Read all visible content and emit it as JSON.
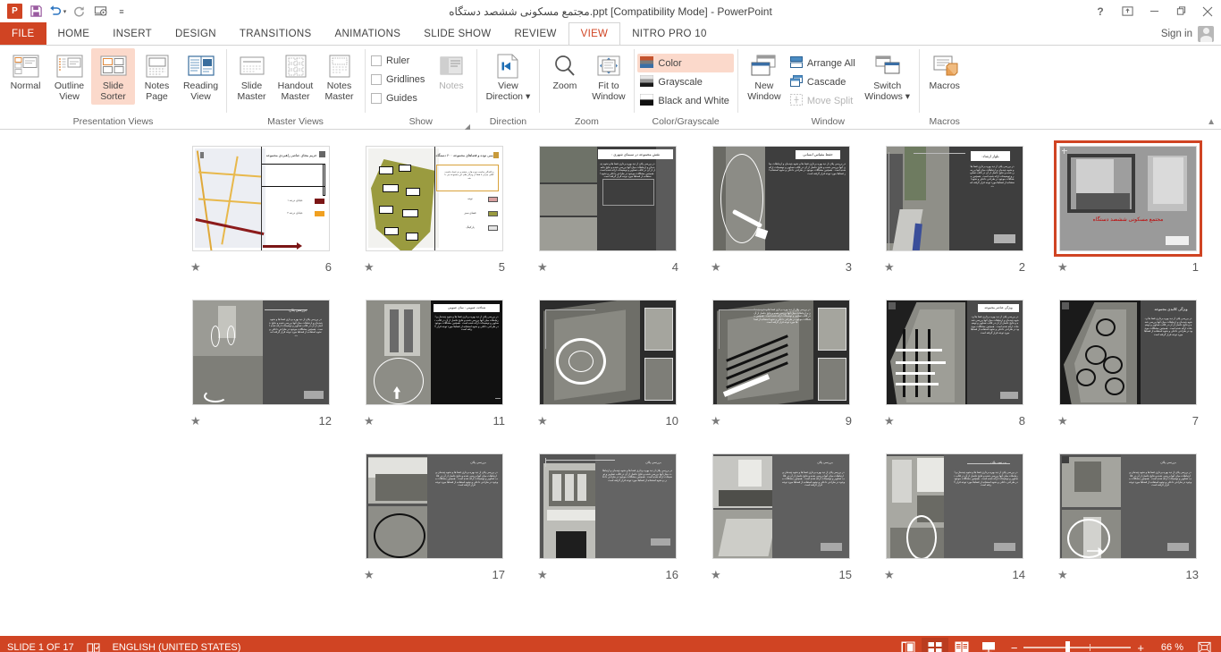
{
  "window": {
    "title": "مجتمع مسکونی ششصد دستگاه.ppt [Compatibility Mode] - PowerPoint",
    "help_icon": "?",
    "ribbon_display_icon": "ribbon-display-options-icon",
    "minimize_icon": "—",
    "restore_icon": "❐",
    "close_icon": "✕",
    "sign_in": "Sign in"
  },
  "quick_access": {
    "logo": "P",
    "save": "save-icon",
    "undo": "undo-icon",
    "redo": "redo-icon",
    "start_slideshow": "start-from-beginning-icon",
    "customize": "customize-quick-access-toolbar-icon"
  },
  "tabs": [
    {
      "label": "FILE",
      "state": "file"
    },
    {
      "label": "HOME",
      "state": "normal"
    },
    {
      "label": "INSERT",
      "state": "normal"
    },
    {
      "label": "DESIGN",
      "state": "normal"
    },
    {
      "label": "TRANSITIONS",
      "state": "normal"
    },
    {
      "label": "ANIMATIONS",
      "state": "normal"
    },
    {
      "label": "SLIDE SHOW",
      "state": "normal"
    },
    {
      "label": "REVIEW",
      "state": "normal"
    },
    {
      "label": "VIEW",
      "state": "active"
    },
    {
      "label": "NITRO PRO 10",
      "state": "normal"
    }
  ],
  "ribbon": {
    "collapse_icon": "^",
    "groups": [
      {
        "name": "Presentation Views",
        "label": "Presentation Views",
        "buttons": [
          {
            "line1": "Normal",
            "line2": "",
            "selected": false
          },
          {
            "line1": "Outline",
            "line2": "View",
            "selected": false
          },
          {
            "line1": "Slide",
            "line2": "Sorter",
            "selected": true
          },
          {
            "line1": "Notes",
            "line2": "Page",
            "selected": false
          },
          {
            "line1": "Reading",
            "line2": "View",
            "selected": false
          }
        ]
      },
      {
        "name": "Master Views",
        "label": "Master Views",
        "buttons": [
          {
            "line1": "Slide",
            "line2": "Master",
            "selected": false
          },
          {
            "line1": "Handout",
            "line2": "Master",
            "selected": false
          },
          {
            "line1": "Notes",
            "line2": "Master",
            "selected": false
          }
        ]
      },
      {
        "name": "Show",
        "label": "Show",
        "has_dialog_launcher": true,
        "checkboxes": [
          {
            "label": "Ruler",
            "checked": false
          },
          {
            "label": "Gridlines",
            "checked": false
          },
          {
            "label": "Guides",
            "checked": false
          }
        ],
        "buttons": [
          {
            "line1": "Notes",
            "line2": "",
            "selected": false,
            "disabled": true
          }
        ]
      },
      {
        "name": "Direction",
        "label": "Direction",
        "buttons": [
          {
            "line1": "View",
            "line2": "Direction ▾",
            "selected": false
          }
        ]
      },
      {
        "name": "Zoom",
        "label": "Zoom",
        "buttons": [
          {
            "line1": "Zoom",
            "line2": "",
            "selected": false
          },
          {
            "line1": "Fit to",
            "line2": "Window",
            "selected": false
          }
        ]
      },
      {
        "name": "Color/Grayscale",
        "label": "Color/Grayscale",
        "options": [
          {
            "label": "Color",
            "selected": true
          },
          {
            "label": "Grayscale",
            "selected": false
          },
          {
            "label": "Black and White",
            "selected": false
          }
        ]
      },
      {
        "name": "Window",
        "label": "Window",
        "buttons": [
          {
            "line1": "New",
            "line2": "Window",
            "selected": false
          }
        ],
        "options": [
          {
            "label": "Arrange All",
            "disabled": false
          },
          {
            "label": "Cascade",
            "disabled": false
          },
          {
            "label": "Move Split",
            "disabled": true
          }
        ],
        "buttons2": [
          {
            "line1": "Switch",
            "line2": "Windows ▾",
            "selected": false
          }
        ]
      },
      {
        "name": "Macros",
        "label": "Macros",
        "buttons": [
          {
            "line1": "Macros",
            "line2": "",
            "selected": false
          }
        ]
      }
    ]
  },
  "sorter": {
    "slides": [
      {
        "number": "6",
        "star": "★",
        "selected": false,
        "kind": "map-plan",
        "title": "حریم بنجای عناصر راهبردی مجموعه",
        "legend": [
          "خیابان درجه ۱",
          "خیابان درجه ۲"
        ]
      },
      {
        "number": "5",
        "star": "★",
        "selected": false,
        "kind": "map-green",
        "title": "بررسی توده و فضاهای مجموعه ۶۰۰ دستگاه",
        "legend": [
          "توده",
          "فضای سبز",
          "پارکینگ"
        ]
      },
      {
        "number": "4",
        "star": "★",
        "selected": false,
        "kind": "dark-photos3",
        "title": "نقش مجموعه در سیمای شهری :"
      },
      {
        "number": "3",
        "star": "★",
        "selected": false,
        "kind": "dark-ellipse",
        "title": "حفظ مقیاس انسانی"
      },
      {
        "number": "2",
        "star": "★",
        "selected": false,
        "kind": "dark-street",
        "title": "بلوار ارشاد:"
      },
      {
        "number": "1",
        "star": "★",
        "selected": true,
        "kind": "cover",
        "title": "مجتمع مسکونی ششصد دستگاه"
      },
      {
        "number": "12",
        "star": "★",
        "selected": false,
        "kind": "interior-arrow",
        "title": "بررسی پلان"
      },
      {
        "number": "11",
        "star": "★",
        "selected": false,
        "kind": "facade-circle",
        "title": "شناخت عمومی : نمای عمومی"
      },
      {
        "number": "10",
        "star": "★",
        "selected": false,
        "kind": "aerial-flower",
        "title": ""
      },
      {
        "number": "9",
        "star": "★",
        "selected": false,
        "kind": "aerial-lines",
        "title": ""
      },
      {
        "number": "8",
        "star": "★",
        "selected": false,
        "kind": "aerial-grid",
        "title": "ویژگی عناصر مجموعه"
      },
      {
        "number": "7",
        "star": "★",
        "selected": false,
        "kind": "aerial-circles",
        "title": "ویژگی کالبدی مجموعه"
      },
      {
        "number": "17",
        "star": "★",
        "selected": false,
        "kind": "photo-ellipse",
        "title": "بررسی پلان"
      },
      {
        "number": "16",
        "star": "★",
        "selected": false,
        "kind": "photo-room",
        "title": "بررسی پلان"
      },
      {
        "number": "15",
        "star": "★",
        "selected": false,
        "kind": "photo-room2",
        "title": "بررسی پلان"
      },
      {
        "number": "14",
        "star": "★",
        "selected": false,
        "kind": "photo-kitchen",
        "title": "بررسی پلان"
      },
      {
        "number": "13",
        "star": "★",
        "selected": false,
        "kind": "photo-sofa",
        "title": "بررسی پلان"
      }
    ],
    "body_text": "در بررسی پلان از دید بهره برداری فضا ها و نحوه چیدمان و ارتباطات میان آنها بررسی شده و نتایج حاصل از آن در قالب تصاویر و توضیحات ارائه شده است . همچنین مشکلات موجود در طراحی داخلی و نحوه استفاده از فضاها مورد توجه قرار گرفته است",
    "title_bar_placeholder": "عنوان"
  },
  "status": {
    "slide_count": "SLIDE 1 OF 17",
    "notes_icon": "spelling-icon",
    "language": "ENGLISH (UNITED STATES)",
    "view_normal_icon": "normal-view-icon",
    "view_sorter_icon": "slide-sorter-view-icon",
    "view_reading_icon": "reading-view-icon",
    "view_slideshow_icon": "slideshow-view-icon",
    "zoom_out": "−",
    "zoom_in": "+",
    "zoom_level": "66 %",
    "fit_icon": "fit-slide-to-window-icon"
  },
  "colors": {
    "accent": "#d04423",
    "accent_light": "#fbd9cb",
    "text": "#444444",
    "slide_red_title": "#c00000",
    "map_yellow": "#e8b84b",
    "map_green": "#9a9b3f"
  }
}
